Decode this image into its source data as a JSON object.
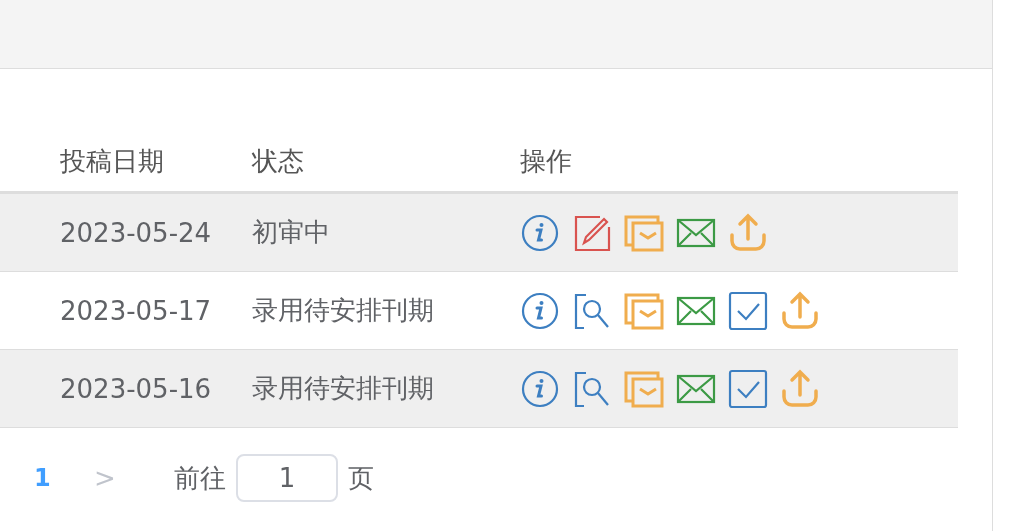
{
  "table": {
    "columns": [
      "投稿日期",
      "状态",
      "操作"
    ],
    "rows": [
      {
        "date": "2023-05-24",
        "status": "初审中",
        "actions": [
          {
            "kind": "info"
          },
          {
            "kind": "edit"
          },
          {
            "kind": "forward"
          },
          {
            "kind": "mail"
          },
          {
            "kind": "upload"
          }
        ]
      },
      {
        "date": "2023-05-17",
        "status": "录用待安排刊期",
        "actions": [
          {
            "kind": "info"
          },
          {
            "kind": "review"
          },
          {
            "kind": "forward"
          },
          {
            "kind": "mail"
          },
          {
            "kind": "confirm"
          },
          {
            "kind": "upload"
          }
        ]
      },
      {
        "date": "2023-05-16",
        "status": "录用待安排刊期",
        "actions": [
          {
            "kind": "info"
          },
          {
            "kind": "review"
          },
          {
            "kind": "forward"
          },
          {
            "kind": "mail"
          },
          {
            "kind": "confirm"
          },
          {
            "kind": "upload"
          }
        ]
      }
    ]
  },
  "pagination": {
    "pages": [
      {
        "label": "1",
        "selected": true
      }
    ],
    "next": {
      "label": ">",
      "disabled": true
    },
    "goto_label": "前往",
    "goto_value": "1",
    "page_suffix": "页"
  }
}
